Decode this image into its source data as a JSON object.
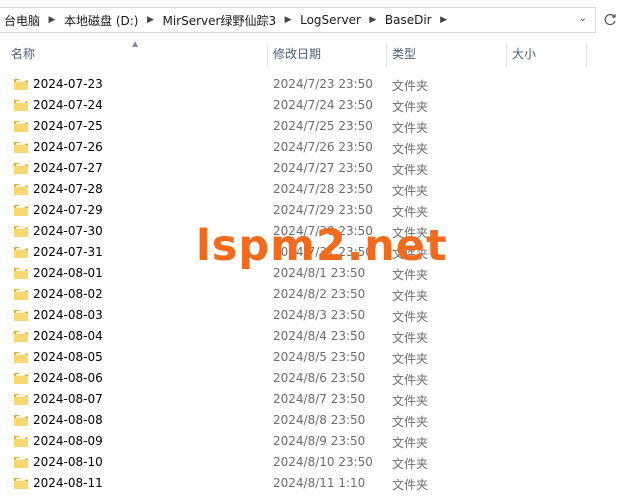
{
  "breadcrumb": {
    "items": [
      "台电脑",
      "本地磁盘 (D:)",
      "MirServer绿野仙踪3",
      "LogServer",
      "BaseDir"
    ]
  },
  "columns": {
    "name": "名称",
    "date": "修改日期",
    "type": "类型",
    "size": "大小"
  },
  "rows": [
    {
      "name": "2024-07-23",
      "date": "2024/7/23 23:50",
      "type": "文件夹"
    },
    {
      "name": "2024-07-24",
      "date": "2024/7/24 23:50",
      "type": "文件夹"
    },
    {
      "name": "2024-07-25",
      "date": "2024/7/25 23:50",
      "type": "文件夹"
    },
    {
      "name": "2024-07-26",
      "date": "2024/7/26 23:50",
      "type": "文件夹"
    },
    {
      "name": "2024-07-27",
      "date": "2024/7/27 23:50",
      "type": "文件夹"
    },
    {
      "name": "2024-07-28",
      "date": "2024/7/28 23:50",
      "type": "文件夹"
    },
    {
      "name": "2024-07-29",
      "date": "2024/7/29 23:50",
      "type": "文件夹"
    },
    {
      "name": "2024-07-30",
      "date": "2024/7/30 23:50",
      "type": "文件夹"
    },
    {
      "name": "2024-07-31",
      "date": "2024/7/31 23:50",
      "type": "文件夹"
    },
    {
      "name": "2024-08-01",
      "date": "2024/8/1 23:50",
      "type": "文件夹"
    },
    {
      "name": "2024-08-02",
      "date": "2024/8/2 23:50",
      "type": "文件夹"
    },
    {
      "name": "2024-08-03",
      "date": "2024/8/3 23:50",
      "type": "文件夹"
    },
    {
      "name": "2024-08-04",
      "date": "2024/8/4 23:50",
      "type": "文件夹"
    },
    {
      "name": "2024-08-05",
      "date": "2024/8/5 23:50",
      "type": "文件夹"
    },
    {
      "name": "2024-08-06",
      "date": "2024/8/6 23:50",
      "type": "文件夹"
    },
    {
      "name": "2024-08-07",
      "date": "2024/8/7 23:50",
      "type": "文件夹"
    },
    {
      "name": "2024-08-08",
      "date": "2024/8/8 23:50",
      "type": "文件夹"
    },
    {
      "name": "2024-08-09",
      "date": "2024/8/9 23:50",
      "type": "文件夹"
    },
    {
      "name": "2024-08-10",
      "date": "2024/8/10 23:50",
      "type": "文件夹"
    },
    {
      "name": "2024-08-11",
      "date": "2024/8/11 1:10",
      "type": "文件夹"
    }
  ],
  "watermark": "lspm2.net",
  "icons": {
    "folder": "folder-icon",
    "separator": "chevron-right-icon",
    "dropdown": "chevron-down-icon",
    "refresh": "refresh-icon",
    "sort": "sort-ascending-icon"
  },
  "colors": {
    "header_text": "#4c607a",
    "secondary_text": "#6d6d6d",
    "watermark": "#f26a1b",
    "folder_fill": "#f8d775",
    "folder_dark": "#e0b23c"
  }
}
